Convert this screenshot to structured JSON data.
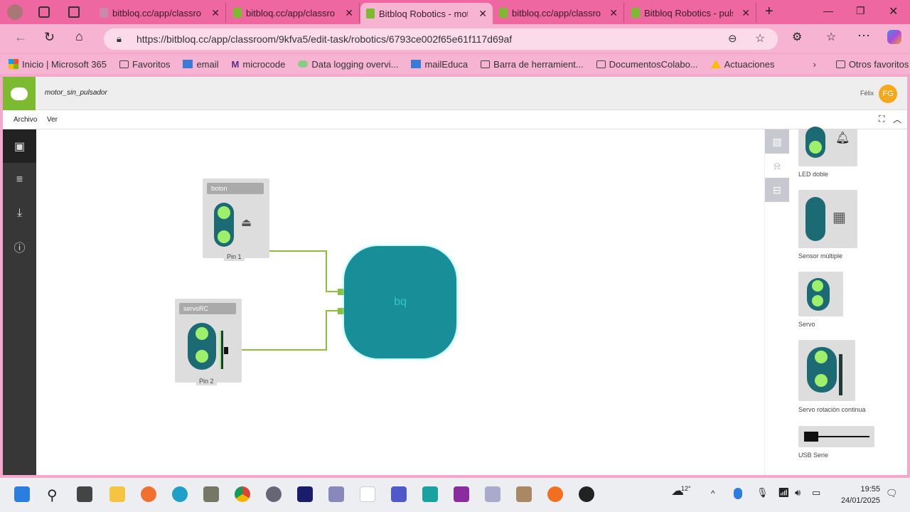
{
  "browser": {
    "tabs": [
      {
        "title": "bitbloq.cc/app/classroo",
        "active": false
      },
      {
        "title": "bitbloq.cc/app/classroo",
        "active": false
      },
      {
        "title": "Bitbloq Robotics - moto",
        "active": true
      },
      {
        "title": "bitbloq.cc/app/classroo",
        "active": false
      },
      {
        "title": "Bitbloq Robotics - pulsa",
        "active": false
      }
    ],
    "url": "https://bitbloq.cc/app/classroom/9kfva5/edit-task/robotics/6793ce002f65e61f117d69af",
    "bookmarks": [
      "Inicio | Microsoft 365",
      "Favoritos",
      "email",
      "microcode",
      "Data logging overvi...",
      "mailEduca",
      "Barra de herramient...",
      "DocumentosColabo...",
      "Actuaciones"
    ],
    "other_favorites": "Otros favoritos"
  },
  "app": {
    "project_name": "motor_sin_pulsador",
    "user_name": "Félix",
    "user_initials": "FG",
    "menu": [
      "Archivo",
      "Ver"
    ]
  },
  "canvas": {
    "blocks": [
      {
        "name": "boton",
        "pin": "Pin 1"
      },
      {
        "name": "servoRC",
        "pin": "Pin 2"
      }
    ],
    "board_label": "bq"
  },
  "components": [
    "LED doble",
    "Sensor múltiple",
    "Servo",
    "Servo rotación continua",
    "USB Serie"
  ],
  "taskbar": {
    "weather": "12°",
    "time": "19:55",
    "date": "24/01/2025"
  },
  "colors": {
    "accent": "#7cbb2f",
    "board": "#178e98",
    "browser": "#ee67a0"
  }
}
